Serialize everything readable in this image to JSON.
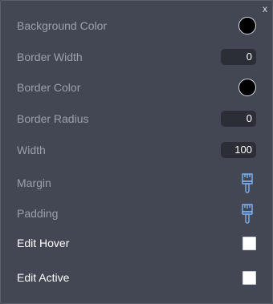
{
  "panel": {
    "close_label": "x",
    "rows": {
      "background_color": {
        "label": "Background Color",
        "color": "#000000"
      },
      "border_width": {
        "label": "Border Width",
        "value": "0"
      },
      "border_color": {
        "label": "Border Color",
        "color": "#000000"
      },
      "border_radius": {
        "label": "Border Radius",
        "value": "0"
      },
      "width": {
        "label": "Width",
        "value": "100"
      },
      "margin": {
        "label": "Margin",
        "icon": "paintbrush-icon"
      },
      "padding": {
        "label": "Padding",
        "icon": "paintbrush-icon"
      },
      "edit_hover": {
        "label": "Edit Hover",
        "checked": false
      },
      "edit_active": {
        "label": "Edit Active",
        "checked": false
      }
    }
  },
  "colors": {
    "panel_bg": "#424753",
    "label_dim": "#9aa0ad",
    "label_bright": "#ffffff",
    "input_bg": "#2b2e36",
    "brush_icon": "#7fb2f0"
  }
}
